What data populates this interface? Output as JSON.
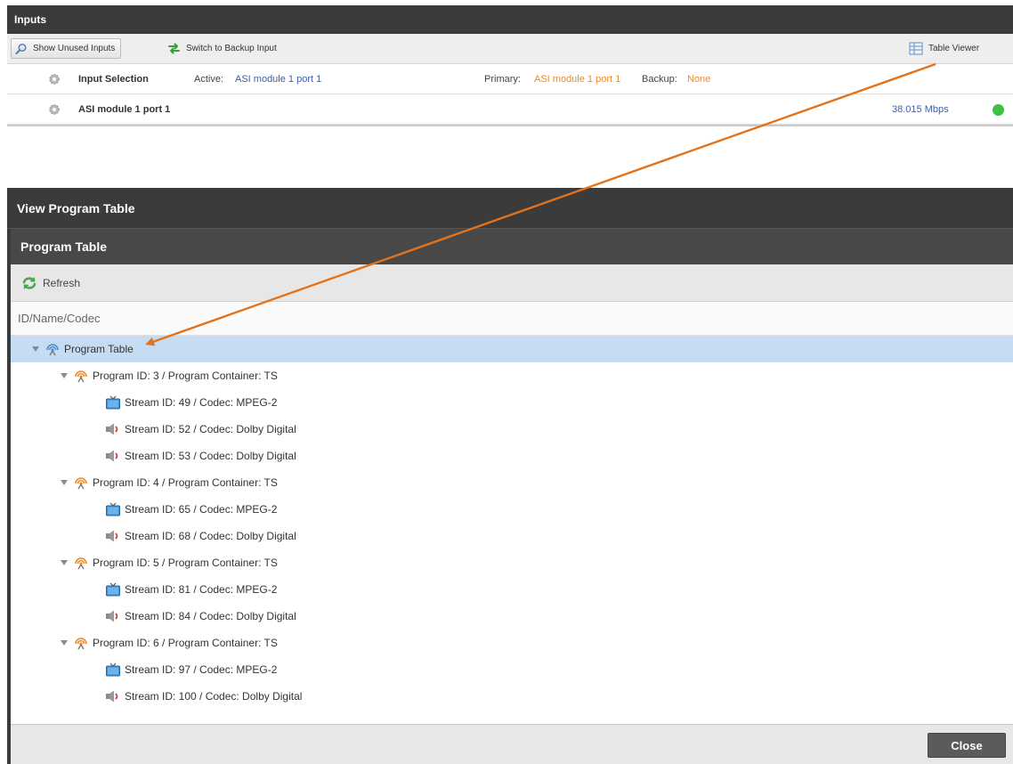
{
  "inputs": {
    "title": "Inputs",
    "toolbar": {
      "show_unused": "Show Unused Inputs",
      "switch_backup": "Switch to Backup Input",
      "table_viewer": "Table Viewer"
    },
    "selection_row": {
      "name": "Input Selection",
      "active_label": "Active:",
      "active_value": "ASI module 1 port 1",
      "primary_label": "Primary:",
      "primary_value": "ASI module 1 port 1",
      "backup_label": "Backup:",
      "backup_value": "None"
    },
    "module_row": {
      "name": "ASI module 1 port 1",
      "bitrate": "38.015  Mbps",
      "status_color": "#3ec13e"
    }
  },
  "dialog": {
    "title": "View Program Table",
    "panel_title": "Program Table",
    "refresh_label": "Refresh",
    "column_header": "ID/Name/Codec",
    "close_label": "Close",
    "tree": {
      "root": "Program Table",
      "programs": [
        {
          "label": "Program ID: 3 / Program Container: TS",
          "streams": [
            {
              "type": "video",
              "label": "Stream ID: 49 / Codec: MPEG-2"
            },
            {
              "type": "audio",
              "label": "Stream ID: 52 / Codec: Dolby Digital"
            },
            {
              "type": "audio",
              "label": "Stream ID: 53 / Codec: Dolby Digital"
            }
          ]
        },
        {
          "label": "Program ID: 4 / Program Container: TS",
          "streams": [
            {
              "type": "video",
              "label": "Stream ID: 65 / Codec: MPEG-2"
            },
            {
              "type": "audio",
              "label": "Stream ID: 68 / Codec: Dolby Digital"
            }
          ]
        },
        {
          "label": "Program ID: 5 / Program Container: TS",
          "streams": [
            {
              "type": "video",
              "label": "Stream ID: 81 / Codec: MPEG-2"
            },
            {
              "type": "audio",
              "label": "Stream ID: 84 / Codec: Dolby Digital"
            }
          ]
        },
        {
          "label": "Program ID: 6 / Program Container: TS",
          "streams": [
            {
              "type": "video",
              "label": "Stream ID: 97 / Codec: MPEG-2"
            },
            {
              "type": "audio",
              "label": "Stream ID: 100 / Codec: Dolby Digital"
            }
          ]
        }
      ]
    }
  },
  "colors": {
    "header_dark": "#3b3b3b",
    "selected_row": "#c6dcf3",
    "link_blue": "#3a5fa8",
    "value_orange": "#f08a24",
    "annotation_arrow": "#e2731c"
  },
  "icons": {
    "search": "search-icon",
    "switch": "switch-icon",
    "table_viewer": "table-viewer-icon",
    "gear": "gear-icon",
    "refresh": "refresh-icon",
    "program_table": "broadcast-icon",
    "video": "tv-icon",
    "audio": "speaker-icon"
  }
}
